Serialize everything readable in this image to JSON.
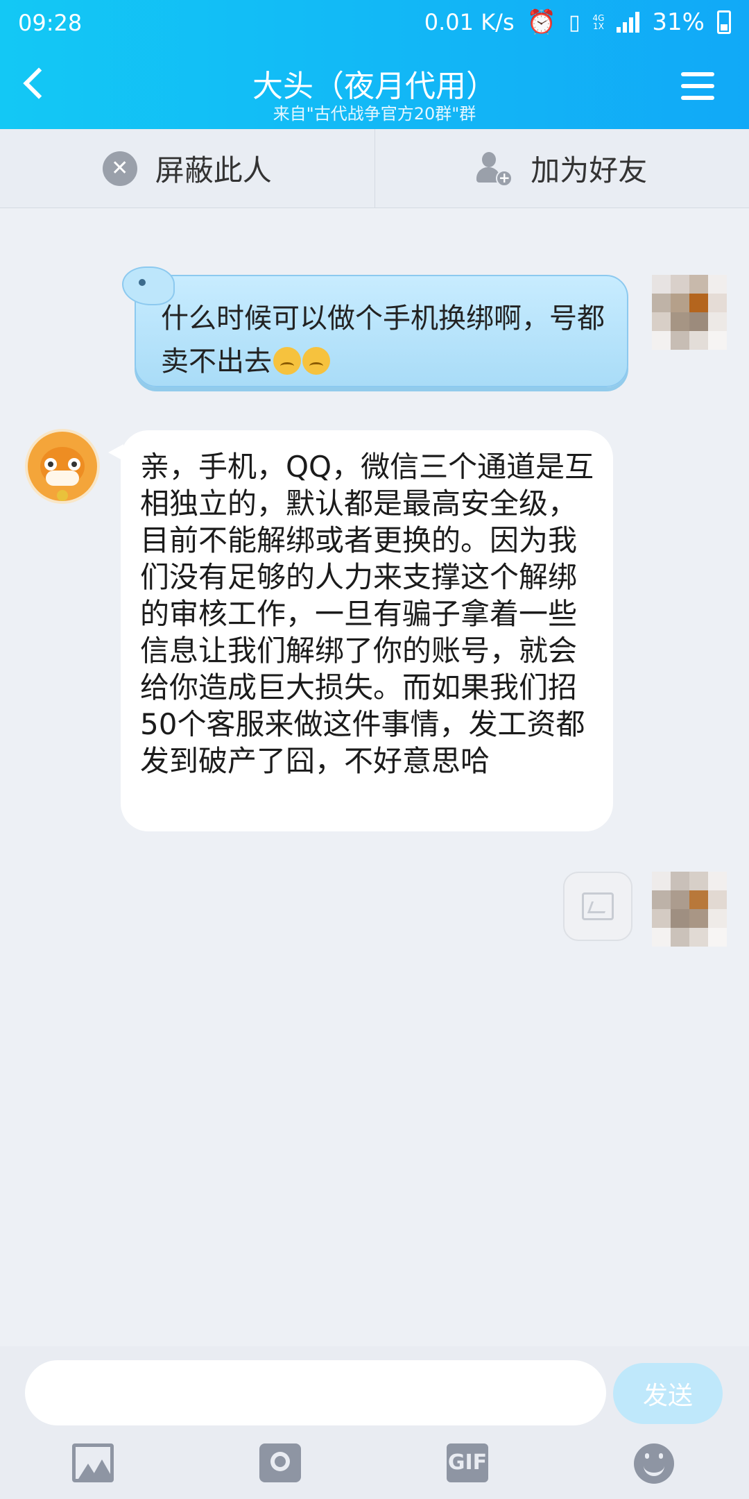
{
  "status_bar": {
    "time": "09:28",
    "net_speed": "0.01 K/s",
    "network": "4G",
    "network_sub": "1X",
    "battery": "31%"
  },
  "header": {
    "title": "大头（夜月代用）",
    "subtitle": "来自\"古代战争官方20群\"群",
    "back_icon": "chevron-left-icon",
    "menu_icon": "hamburger-menu-icon"
  },
  "actions": {
    "block_label": "屏蔽此人",
    "add_friend_label": "加为好友"
  },
  "messages": [
    {
      "side": "right",
      "text": "什么时候可以做个手机换绑啊，号都卖不出去",
      "emojis": [
        "crying-emoji",
        "crying-emoji"
      ]
    },
    {
      "side": "left",
      "text": "亲，手机，QQ，微信三个通道是互相独立的，默认都是最高安全级，目前不能解绑或者更换的。因为我们没有足够的人力来支撑这个解绑的审核工作，一旦有骗子拿着一些信息让我们解绑了你的账号，就会给你造成巨大损失。而如果我们招50个客服来做这件事情，发工资都发到破产了囧，不好意思哈"
    },
    {
      "side": "right",
      "type": "image",
      "placeholder_icon": "broken-image-icon"
    }
  ],
  "input": {
    "value": "",
    "send_label": "发送"
  },
  "toolbar": {
    "gif_label": "GIF"
  },
  "colors": {
    "header": "#11a9f7",
    "outgoing_bubble": "#a9dcf7",
    "background": "#edf0f5"
  }
}
